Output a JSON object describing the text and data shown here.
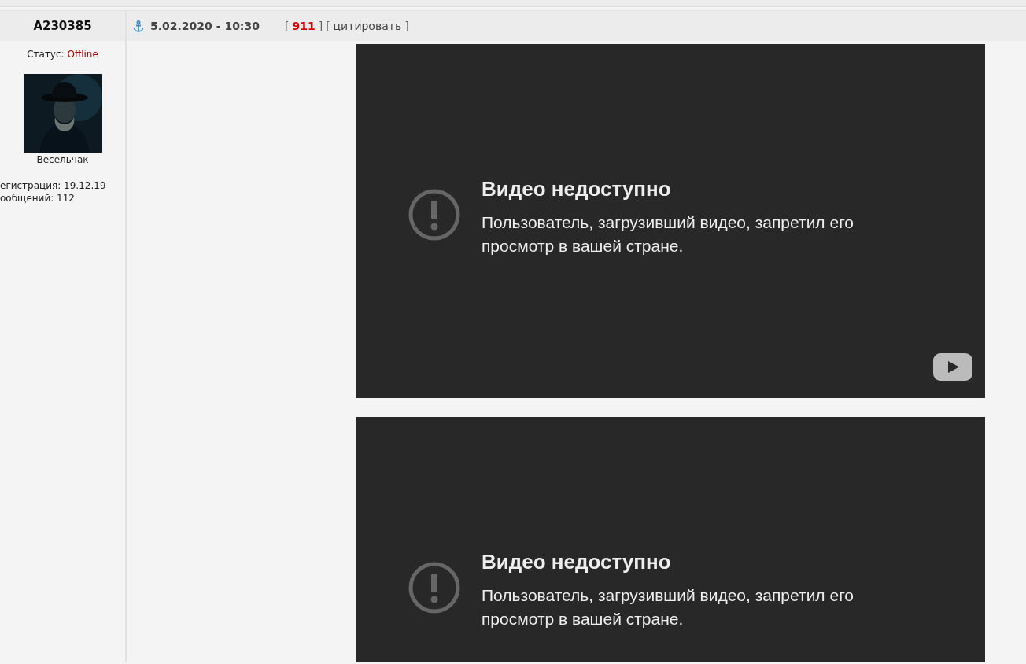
{
  "post": {
    "author": "A230385",
    "date": "5.02.2020 - 10:30",
    "number_link": {
      "open": "[",
      "text": "911",
      "close": "]"
    },
    "quote_link": {
      "open": "[",
      "text": "цитировать",
      "close": "]"
    },
    "status_label": "Статус:",
    "status": "Offline",
    "rank": "Весельчак",
    "registration": "егистрация: 19.12.19",
    "messages": "ообщений: 112"
  },
  "videos": [
    {
      "title": "Видео недоступно",
      "message": "Пользователь, загрузивший видео, запретил его просмотр в вашей стране.",
      "play_button": true
    },
    {
      "title": "Видео недоступно",
      "message": "Пользователь, загрузивший видео, запретил его просмотр в вашей стране."
    }
  ]
}
